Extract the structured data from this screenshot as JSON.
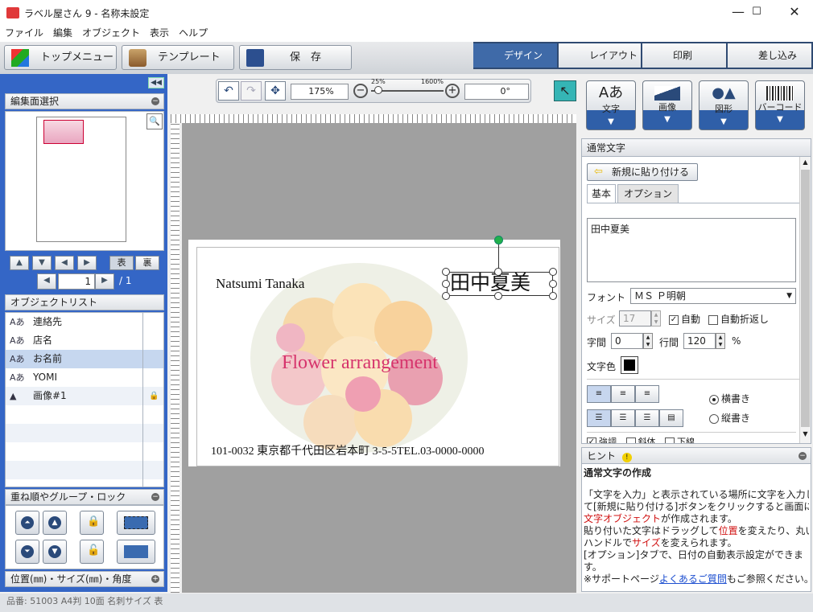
{
  "window": {
    "title": "ラベル屋さん 9 - 名称未設定",
    "min": "—",
    "max": "☐",
    "close": "✕"
  },
  "menu": [
    "ファイル",
    "編集",
    "オブジェクト",
    "表示",
    "ヘルプ"
  ],
  "toolbar": {
    "top_menu": "トップメニュー",
    "template": "テンプレート",
    "save": "保　存"
  },
  "modes": {
    "design": "デザイン",
    "layout": "レイアウト",
    "print": "印刷",
    "merge": "差し込み"
  },
  "left": {
    "page_select_title": "編集面選択",
    "front_label": "表",
    "back_label": "裏",
    "page_number": "1",
    "page_total": "/ 1",
    "object_list_title": "オブジェクトリスト",
    "objects": [
      {
        "icon": "Aあ",
        "label": "連絡先"
      },
      {
        "icon": "Aあ",
        "label": "店名"
      },
      {
        "icon": "Aあ",
        "label": "お名前"
      },
      {
        "icon": "Aあ",
        "label": "YOMI"
      },
      {
        "icon": "▲",
        "label": "画像#1"
      }
    ],
    "order_title": "重ね順やグループ・ロック",
    "position_title": "位置(㎜)・サイズ(㎜)・角度"
  },
  "zoom": {
    "value": "175%",
    "min_label": "25%",
    "max_label": "1600%",
    "rotation": "0°",
    "slider_fraction": 0.1
  },
  "card": {
    "name_en": "Natsumi Tanaka",
    "name_jp": "田中夏美",
    "tagline": "Flower arrangement",
    "address": "101-0032 東京都千代田区岩本町 3-5-5TEL.03-0000-0000"
  },
  "objbuttons": {
    "text": "文字",
    "image": "画像",
    "shape": "図形",
    "barcode": "バーコード"
  },
  "props": {
    "title": "通常文字",
    "paste_new": "新規に貼り付ける",
    "tab_basic": "基本",
    "tab_option": "オプション",
    "text_value": "田中夏美",
    "font_label": "フォント",
    "font_value": "ＭＳ Ｐ明朝",
    "size_label": "サイズ",
    "size_value": "17",
    "auto_label": "自動",
    "wrap_label": "自動折返し",
    "char_spacing_label": "字間",
    "char_spacing_value": "0",
    "line_spacing_label": "行間",
    "line_spacing_value": "120",
    "percent": "%",
    "color_label": "文字色",
    "horizontal": "横書き",
    "vertical": "縦書き",
    "bold": "強調",
    "italic": "斜体",
    "underline": "下線"
  },
  "hint": {
    "title": "ヒント",
    "heading": "通常文字の作成",
    "l1": "「文字を入力」と表示されている場所に文字を入力し",
    "l2": "て[新規に貼り付ける]ボタンをクリックすると画面に",
    "l3a": "文字オブジェクト",
    "l3b": "が作成されます。",
    "l4a": "貼り付いた文字はドラッグして",
    "l4b": "位置",
    "l4c": "を変えたり、丸い",
    "l5a": "ハンドルで",
    "l5b": "サイズ",
    "l5c": "を変えられます。",
    "l6": "[オプション]タブで、日付の自動表示設定ができま",
    "l7": "す。",
    "l8a": "※サポートページ",
    "l8b": "よくあるご質問",
    "l8c": "もご参照ください。"
  },
  "status": "品番: 51003 A4判 10面 名刺サイズ 表",
  "colors": {
    "accent": "#3466c6",
    "tagline": "#d6336c",
    "handle": "#22b14c"
  }
}
